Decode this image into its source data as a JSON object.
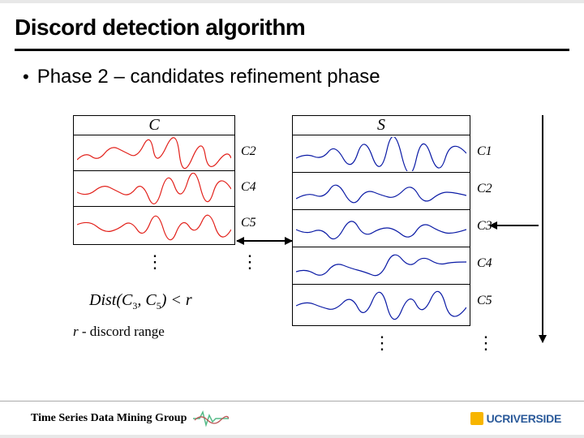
{
  "title": "Discord detection algorithm",
  "bullet": "Phase 2 – candidates refinement phase",
  "panels": {
    "c": {
      "header": "C",
      "row_labels": [
        "C2",
        "C4",
        "C5"
      ]
    },
    "s": {
      "header": "S",
      "row_labels": [
        "C1",
        "C2",
        "C3",
        "C4",
        "C5"
      ]
    }
  },
  "ellipsis": "⋮",
  "formula": "Dist(C3, C5) < r",
  "r_note_sym": "r",
  "r_note_sep": "- ",
  "r_note_text": "discord range",
  "footer": {
    "group": "Time Series Data Mining Group",
    "ucr_uc": "UC",
    "ucr_riverside": "RIVERSIDE"
  }
}
